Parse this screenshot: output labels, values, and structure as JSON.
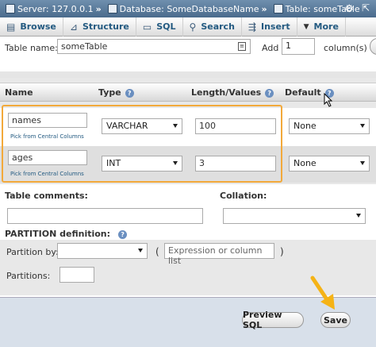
{
  "breadcrumb": {
    "server": "Server: 127.0.0.1",
    "database": "Database: SomeDatabaseName",
    "table": "Table: someTable",
    "separator": "»"
  },
  "tabs": [
    {
      "label": "Browse",
      "icon": "browse-icon"
    },
    {
      "label": "Structure",
      "icon": "structure-icon"
    },
    {
      "label": "SQL",
      "icon": "sql-icon"
    },
    {
      "label": "Search",
      "icon": "search-icon"
    },
    {
      "label": "Insert",
      "icon": "insert-icon"
    },
    {
      "label": "More",
      "icon": "chevron-down-icon"
    }
  ],
  "table_name": {
    "label": "Table name:",
    "value": "someTable"
  },
  "add_columns": {
    "label": "Add",
    "value": "1",
    "suffix": "column(s)"
  },
  "columns_header": {
    "name": "Name",
    "type": "Type",
    "length": "Length/Values",
    "default": "Default"
  },
  "columns": [
    {
      "name": "names",
      "link": "Pick from Central Columns",
      "type": "VARCHAR",
      "length": "100",
      "default": "None"
    },
    {
      "name": "ages",
      "link": "Pick from Central Columns",
      "type": "INT",
      "length": "3",
      "default": "None"
    }
  ],
  "table_comments": {
    "label": "Table comments:",
    "value": ""
  },
  "collation": {
    "label": "Collation:",
    "value": ""
  },
  "partition": {
    "label": "PARTITION definition:",
    "by_label": "Partition by:",
    "by_value": "",
    "open_paren": "(",
    "close_paren": ")",
    "expression_placeholder": "Expression or column list",
    "partitions_label": "Partitions:",
    "partitions_value": ""
  },
  "buttons": {
    "preview": "Preview SQL",
    "save": "Save"
  },
  "colors": {
    "highlight": "#f2a93b",
    "arrow": "#f5b316",
    "link": "#235a81"
  }
}
